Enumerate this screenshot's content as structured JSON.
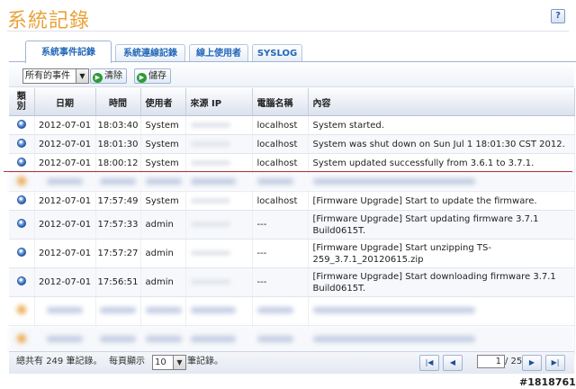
{
  "page": {
    "title": "系統記錄",
    "help_icon": "?"
  },
  "tabs": [
    {
      "label": "系統事件記錄",
      "active": true
    },
    {
      "label": "系統連線記錄"
    },
    {
      "label": "線上使用者"
    },
    {
      "label": "SYSLOG"
    }
  ],
  "toolbar": {
    "filter_value": "所有的事件",
    "clear_label": "清除",
    "save_label": "儲存",
    "button_icon": "go-arrow-icon"
  },
  "table": {
    "headers": [
      "類別",
      "日期",
      "時間",
      "使用者",
      "來源 IP",
      "電腦名稱",
      "內容"
    ],
    "rows": [
      {
        "icon": "info-icon",
        "date": "2012-07-01",
        "time": "18:03:40",
        "user": "System",
        "ip": "",
        "computer": "localhost",
        "content": "System started."
      },
      {
        "icon": "info-icon",
        "date": "2012-07-01",
        "time": "18:01:30",
        "user": "System",
        "ip": "",
        "computer": "localhost",
        "content": "System was shut down on Sun Jul 1 18:01:30 CST 2012."
      },
      {
        "icon": "info-icon",
        "date": "2012-07-01",
        "time": "18:00:12",
        "user": "System",
        "ip": "",
        "computer": "localhost",
        "content": "System updated successfully from 3.6.1 to 3.7.1."
      },
      {
        "icon": "warning-icon",
        "date": "",
        "time": "",
        "user": "",
        "ip": "",
        "computer": "",
        "content": "",
        "blurred": true
      },
      {
        "icon": "info-icon",
        "date": "2012-07-01",
        "time": "17:57:49",
        "user": "System",
        "ip": "",
        "computer": "localhost",
        "content": "[Firmware Upgrade] Start to update the firmware."
      },
      {
        "icon": "info-icon",
        "date": "2012-07-01",
        "time": "17:57:33",
        "user": "admin",
        "ip": "",
        "computer": "---",
        "content": "[Firmware Upgrade] Start updating firmware 3.7.1 Build0615T."
      },
      {
        "icon": "info-icon",
        "date": "2012-07-01",
        "time": "17:57:27",
        "user": "admin",
        "ip": "",
        "computer": "---",
        "content": "[Firmware Upgrade] Start unzipping TS-259_3.7.1_20120615.zip"
      },
      {
        "icon": "info-icon",
        "date": "2012-07-01",
        "time": "17:56:51",
        "user": "admin",
        "ip": "",
        "computer": "---",
        "content": "[Firmware Upgrade] Start downloading firmware 3.7.1 Build0615T."
      },
      {
        "icon": "info-icon",
        "date": "",
        "time": "",
        "user": "",
        "ip": "",
        "computer": "",
        "content": "",
        "blurred": true
      },
      {
        "icon": "info-icon",
        "date": "",
        "time": "",
        "user": "",
        "ip": "",
        "computer": "",
        "content": "",
        "blurred": true
      }
    ]
  },
  "footer": {
    "total_prefix": "總共有",
    "total_count": "249",
    "total_suffix": "筆記錄。",
    "per_page_prefix": "每頁顯示",
    "per_page_value": "10",
    "per_page_suffix": "筆記錄。",
    "current_page": "1",
    "total_pages": "/ 25"
  },
  "watermark": "#1818761",
  "colors": {
    "title": "#e8a33a",
    "tab_text": "#2267b8",
    "separator": "#b8343e"
  }
}
